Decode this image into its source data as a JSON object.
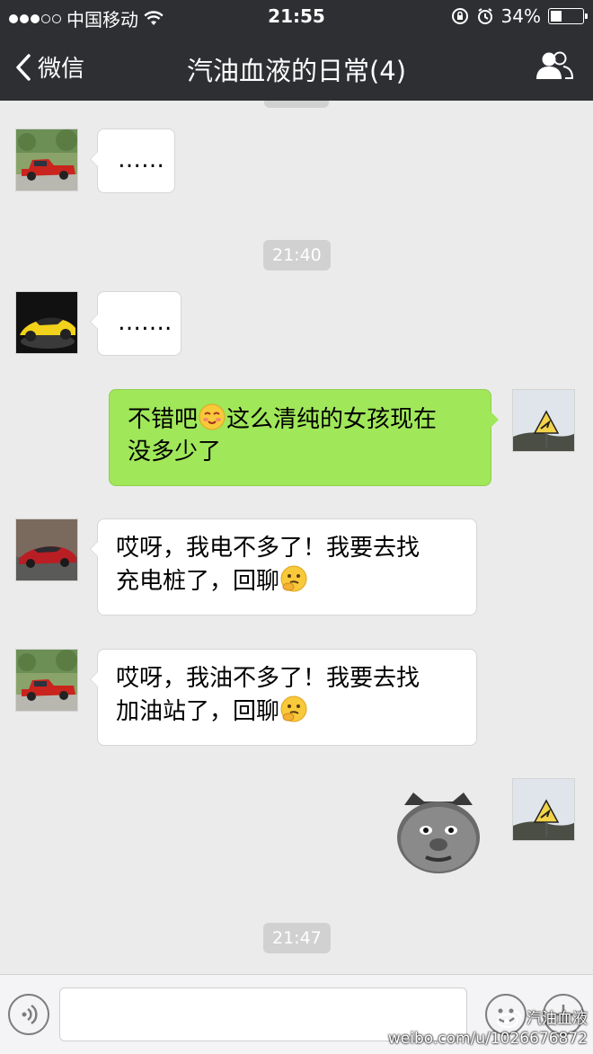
{
  "status_bar": {
    "carrier": "中国移动",
    "time": "21:55",
    "battery_text": "34%",
    "battery_level": 0.34,
    "signal_bars_filled": 3,
    "signal_bars_total": 5
  },
  "nav": {
    "back_label": "微信",
    "title": "汽油血液的日常(4)"
  },
  "timestamps": [
    "21:40",
    "21:47"
  ],
  "messages": [
    {
      "text": "……"
    },
    {
      "text": "……."
    },
    {
      "line1_before": "不错吧",
      "line1_after": "这么清纯的女孩现在",
      "line2": "没多少了"
    },
    {
      "line1": "哎呀，我电不多了！我要去找",
      "line2": "充电桩了，回聊"
    },
    {
      "line1": "哎呀，我油不多了！我要去找",
      "line2": "加油站了，回聊"
    }
  ],
  "watermark": {
    "account": "汽油血液",
    "url": "weibo.com/u/1026676872"
  },
  "colors": {
    "nav_bg": "#2e2f33",
    "chat_bg": "#ebebeb",
    "outgoing_bubble": "#a0e75a",
    "incoming_bubble": "#ffffff",
    "timestamp_bg": "#d1d1d1"
  }
}
